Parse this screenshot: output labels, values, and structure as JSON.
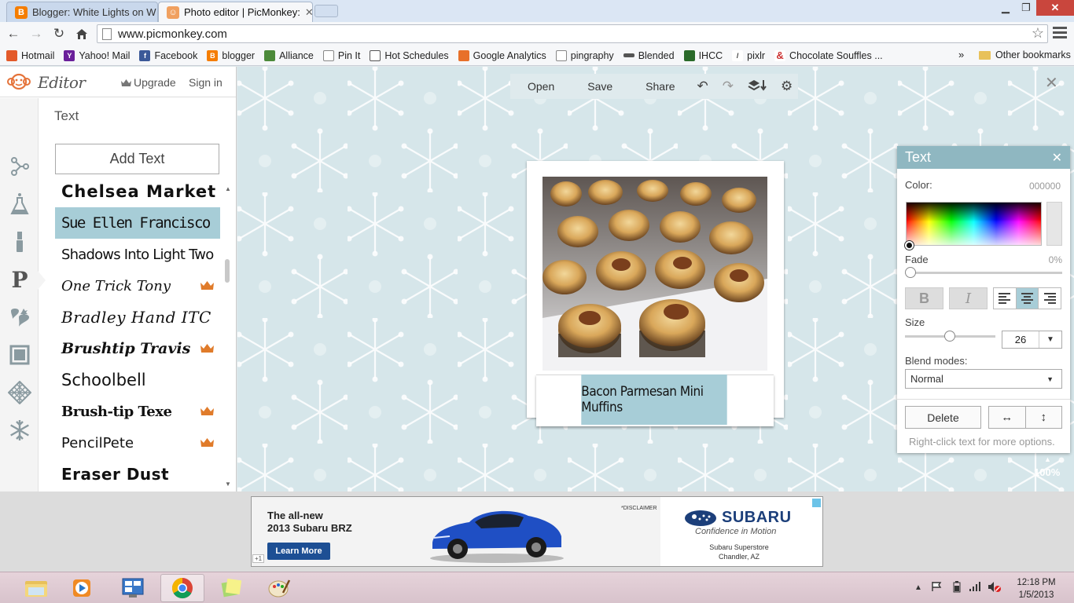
{
  "browser": {
    "tabs": [
      {
        "title": "Blogger: White Lights on W",
        "active": false
      },
      {
        "title": "Photo editor | PicMonkey:",
        "active": true
      }
    ],
    "url": "www.picmonkey.com",
    "bookmarks": [
      {
        "label": "Hotmail",
        "icon": "hotmail-icon"
      },
      {
        "label": "Yahoo! Mail",
        "icon": "yahoo-icon"
      },
      {
        "label": "Facebook",
        "icon": "facebook-icon"
      },
      {
        "label": "blogger",
        "icon": "blogger-icon"
      },
      {
        "label": "Alliance",
        "icon": "alliance-icon"
      },
      {
        "label": "Pin It",
        "icon": "page-icon"
      },
      {
        "label": "Hot Schedules",
        "icon": "calendar-icon"
      },
      {
        "label": "Google Analytics",
        "icon": "analytics-icon"
      },
      {
        "label": "pingraphy",
        "icon": "page-icon"
      },
      {
        "label": "Blended",
        "icon": "blended-icon"
      },
      {
        "label": "IHCC",
        "icon": "ihcc-icon"
      },
      {
        "label": "pixlr",
        "icon": "pixlr-icon"
      },
      {
        "label": "Chocolate Souffles ...",
        "icon": "allrecipes-icon"
      }
    ],
    "more": "»",
    "other_bookmarks": "Other bookmarks"
  },
  "editor": {
    "logo": "Editor",
    "upgrade": "Upgrade",
    "signin": "Sign in",
    "panel_title": "Text",
    "add_text": "Add Text",
    "fonts": [
      {
        "name": "Chelsea Market",
        "premium": false,
        "selected": false
      },
      {
        "name": "Sue Ellen Francisco",
        "premium": false,
        "selected": true
      },
      {
        "name": "Shadows Into Light Two",
        "premium": false,
        "selected": false
      },
      {
        "name": "One Trick Tony",
        "premium": true,
        "selected": false
      },
      {
        "name": "Bradley Hand ITC",
        "premium": false,
        "selected": false
      },
      {
        "name": "Brushtip Travis",
        "premium": true,
        "selected": false
      },
      {
        "name": "Schoolbell",
        "premium": false,
        "selected": false
      },
      {
        "name": "Brush-tip Texe",
        "premium": true,
        "selected": false
      },
      {
        "name": "PencilPete",
        "premium": true,
        "selected": false
      },
      {
        "name": "Eraser Dust",
        "premium": false,
        "selected": false
      }
    ],
    "toolbar": {
      "open": "Open",
      "save": "Save",
      "share": "Share"
    },
    "caption": "Bacon Parmesan Mini Muffins",
    "zoom": "100%"
  },
  "text_palette": {
    "title": "Text",
    "color_label": "Color:",
    "color_value": "000000",
    "fade_label": "Fade",
    "fade_value": "0%",
    "fade": 0,
    "bold": "B",
    "italic": "I",
    "alignment": "center",
    "size_label": "Size",
    "size_value": "26",
    "blend_label": "Blend modes:",
    "blend_value": "Normal",
    "delete": "Delete",
    "flip_h": "↔",
    "flip_v": "↕",
    "hint": "Right-click text for more options."
  },
  "ad": {
    "headline_1": "The all-new",
    "headline_2": "2013 Subaru BRZ",
    "cta": "Learn More",
    "disclaimer": "*DISCLAIMER",
    "brand": "SUBARU",
    "tagline": "Confidence in Motion",
    "store_1": "Subaru Superstore",
    "store_2": "Chandler, AZ",
    "plus": "+1"
  },
  "taskbar": {
    "time": "12:18 PM",
    "date": "1/5/2013"
  },
  "colors": {
    "accent": "#8fb7c1",
    "selection": "#a7cdd7",
    "crown": "#e07b2a",
    "close": "#c9463d"
  }
}
